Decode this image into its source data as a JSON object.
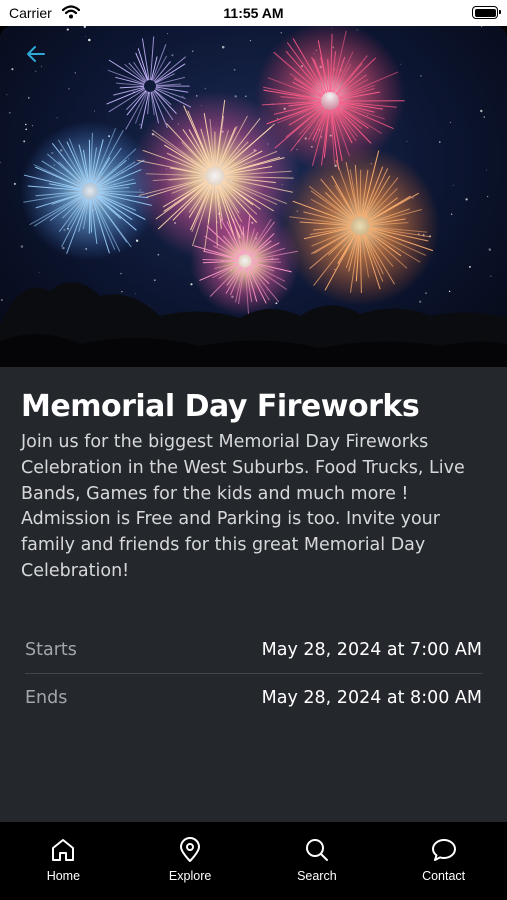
{
  "status_bar": {
    "carrier": "Carrier",
    "time": "11:55 AM"
  },
  "event": {
    "title": "Memorial Day Fireworks",
    "description": "Join us for the biggest Memorial Day Fireworks Celebration in the West Suburbs. Food Trucks, Live Bands, Games for the kids and much more ! Admission is Free and Parking is too. Invite your family and friends for this great Memorial Day Celebration!",
    "details": [
      {
        "label": "Starts",
        "value": "May 28, 2024 at 7:00 AM"
      },
      {
        "label": "Ends",
        "value": "May 28, 2024 at 8:00 AM"
      }
    ]
  },
  "tabs": [
    {
      "label": "Home",
      "icon": "home-icon"
    },
    {
      "label": "Explore",
      "icon": "map-pin-icon"
    },
    {
      "label": "Search",
      "icon": "search-icon"
    },
    {
      "label": "Contact",
      "icon": "chat-bubble-icon"
    }
  ],
  "colors": {
    "card_background": "#24272b",
    "accent": "#2fa8d8",
    "tab_bar": "#000000"
  }
}
